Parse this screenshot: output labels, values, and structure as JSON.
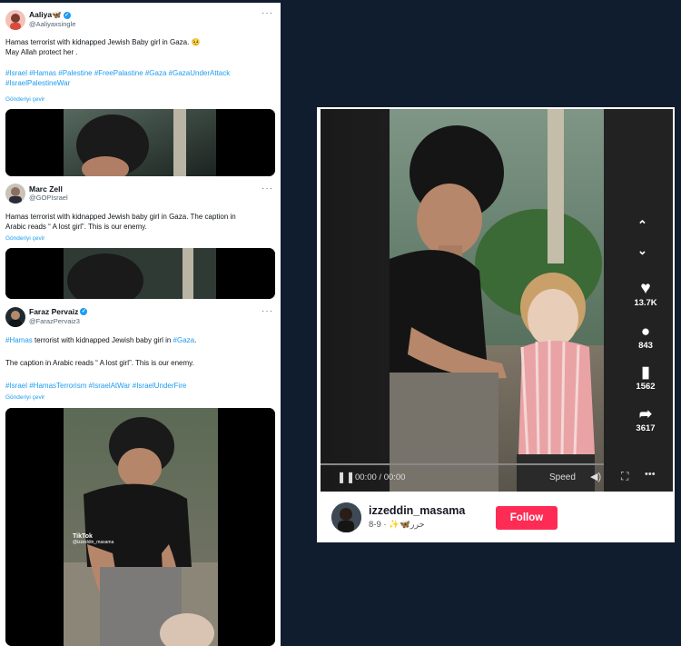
{
  "tweets": [
    {
      "name": "Aaliya🦋",
      "handle": "@Aaliyaxsingle",
      "line1": "Hamas terrorist with kidnapped Jewish Baby girl in Gaza. 🥺",
      "line2": "May Allah protect her .",
      "hashtags1": "#Israel #Hamas #Palestine #FreePalastine #Gaza #GazaUnderAttack",
      "hashtags2": "#IsraelPalestineWar",
      "translate": "Gönderiyi çevir",
      "more": "···"
    },
    {
      "name": "Marc Zell",
      "handle": "@GOPIsrael",
      "line1": "Hamas terrorist with kidnapped Jewish baby girl in Gaza.  The caption in",
      "line2": "Arabic reads “ A lost girl”.  This is our enemy.",
      "translate": "Gönderiyi çevir",
      "more": "···"
    },
    {
      "name": "Faraz Pervaiz",
      "handle": "@FarazPervaiz3",
      "line1_tag": "#Hamas",
      "line1_mid": " terrorist with kidnapped Jewish baby girl in ",
      "line1_tag2": "#Gaza",
      "line1_end": ".",
      "line2": "The caption in Arabic reads “ A lost girl”.  This is our enemy.",
      "hashtags1": "#Israel #HamasTerrorism #IsraelAtWar #IsraelUnderFire",
      "translate": "Gönderiyi çevir",
      "more": "···",
      "watermark1": "TikTok",
      "watermark2": "@izzeddin_masama"
    }
  ],
  "tiktok": {
    "likes": "13.7K",
    "comments": "843",
    "saves": "1562",
    "shares": "3617",
    "time": "00:00 / 00:00",
    "speed": "Speed",
    "username": "izzeddin_masama",
    "sub": "حرر🦋✨ · 9-8",
    "follow": "Follow"
  },
  "colors": {
    "link": "#1d9bf0",
    "follow": "#fe2c55",
    "background": "#0f1d2e"
  }
}
